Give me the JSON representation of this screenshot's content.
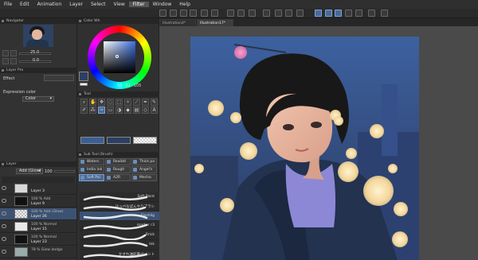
{
  "menu": [
    "File",
    "Edit",
    "Animation",
    "Layer",
    "Select",
    "View",
    "Filter",
    "Window",
    "Help"
  ],
  "menu_active": "Filter",
  "navigator": {
    "title": "Navigator",
    "zoom": "25.0",
    "angle": "0.0"
  },
  "color_wheel": {
    "title": "Color Wh",
    "values": [
      "56",
      "82",
      "105"
    ]
  },
  "layer_property": {
    "title": "Layer Pro",
    "effect_label": "Effect",
    "expression_label": "Expression color",
    "expression_value": "Color"
  },
  "tool": {
    "title": "Tool"
  },
  "sub_tool": {
    "title": "Sub Tool (Brush)",
    "items": [
      "Waterc",
      "Realisti",
      "Thick pa",
      "India ink",
      "Rough",
      "Angel's",
      "Soft Pai",
      "A2R",
      "Mecha"
    ]
  },
  "brushes": [
    {
      "label": "Soft Paint"
    },
    {
      "label": "ほっぺなぼんやりブラシ"
    },
    {
      "label": "Flashlig"
    },
    {
      "label": "marker r3"
    },
    {
      "label": "Brick"
    },
    {
      "label": "Ink"
    },
    {
      "label": "かすれ油彩筆ペイント"
    }
  ],
  "layer_panel": {
    "title": "Layer",
    "blend": "Add (Glow)",
    "opacity": "100"
  },
  "layers": [
    {
      "mode": "",
      "name": "Layer 3",
      "selected": false
    },
    {
      "mode": "100 % Add",
      "name": "Layer 9",
      "selected": false
    },
    {
      "mode": "100 % Add (Glow)",
      "name": "Layer 26",
      "selected": true
    },
    {
      "mode": "100 % Normal",
      "name": "Layer 15",
      "selected": false
    },
    {
      "mode": "100 % Normal",
      "name": "Layer 23",
      "selected": false
    },
    {
      "mode": "78 % Glow dodge",
      "name": "",
      "selected": false
    }
  ],
  "doc_tabs": [
    "Illustration4*",
    "Illustration17*"
  ],
  "colors": {
    "accent": "#4a6a96",
    "main_color": "#2c3f63",
    "sub_color": "#ffffff"
  }
}
